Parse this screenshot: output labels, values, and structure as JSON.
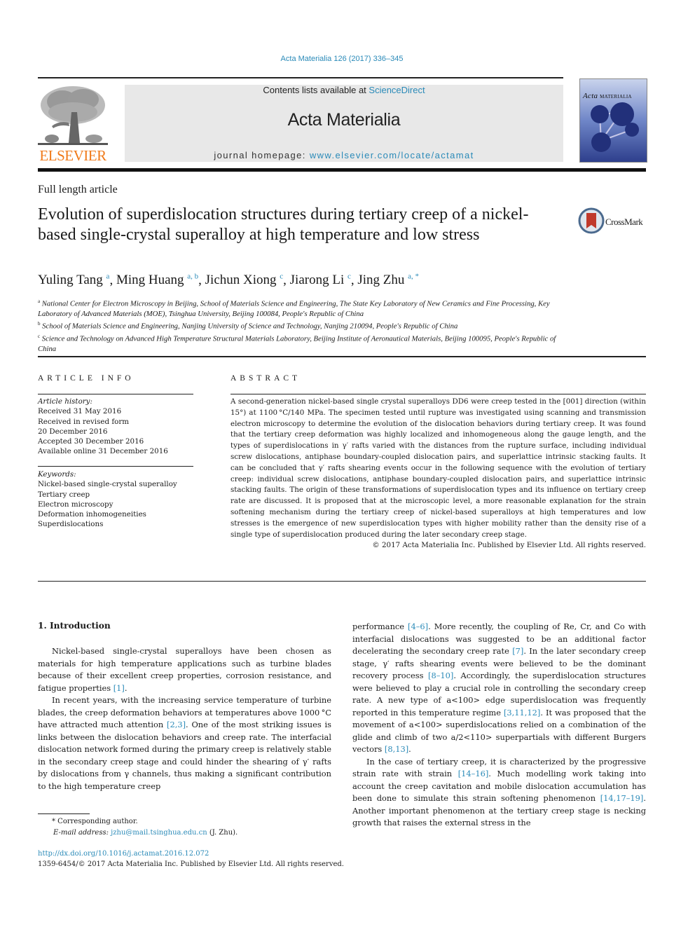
{
  "header": {
    "citation": "Acta Materialia 126 (2017) 336–345",
    "contents_prefix": "Contents lists available at ",
    "contents_link": "ScienceDirect",
    "journal_title": "Acta Materialia",
    "homepage_prefix": "journal homepage: ",
    "homepage_link": "www.elsevier.com/locate/actamat",
    "publisher_logo_text": "ELSEVIER",
    "cover_title_italic": "Acta",
    "cover_title_caps": "MATERIALIA",
    "crossmark_label": "CrossMark"
  },
  "article": {
    "type": "Full length article",
    "title": "Evolution of superdislocation structures during tertiary creep of a nickel-based single-crystal superalloy at high temperature and low stress",
    "authors": [
      {
        "name": "Yuling Tang",
        "sup": "a"
      },
      {
        "name": "Ming Huang",
        "sup": "a, b"
      },
      {
        "name": "Jichun Xiong",
        "sup": "c"
      },
      {
        "name": "Jiarong Li",
        "sup": "c"
      },
      {
        "name": "Jing Zhu",
        "sup": "a, *"
      }
    ],
    "affiliations": [
      {
        "key": "a",
        "text": "National Center for Electron Microscopy in Beijing, School of Materials Science and Engineering, The State Key Laboratory of New Ceramics and Fine Processing, Key Laboratory of Advanced Materials (MOE), Tsinghua University, Beijing 100084, People's Republic of China"
      },
      {
        "key": "b",
        "text": "School of Materials Science and Engineering, Nanjing University of Science and Technology, Nanjing 210094, People's Republic of China"
      },
      {
        "key": "c",
        "text": "Science and Technology on Advanced High Temperature Structural Materials Laboratory, Beijing Institute of Aeronautical Materials, Beijing 100095, People's Republic of China"
      }
    ]
  },
  "article_info": {
    "heading": "ARTICLE INFO",
    "history_label": "Article history:",
    "history": [
      "Received 31 May 2016",
      "Received in revised form",
      "20 December 2016",
      "Accepted 30 December 2016",
      "Available online 31 December 2016"
    ],
    "keywords_label": "Keywords:",
    "keywords": [
      "Nickel-based single-crystal superalloy",
      "Tertiary creep",
      "Electron microscopy",
      "Deformation inhomogeneities",
      "Superdislocations"
    ]
  },
  "abstract": {
    "heading": "ABSTRACT",
    "text": "A second-generation nickel-based single crystal superalloys DD6 were creep tested in the [001] direction (within 15°) at 1100 °C/140 MPa. The specimen tested until rupture was investigated using scanning and transmission electron microscopy to determine the evolution of the dislocation behaviors during tertiary creep. It was found that the tertiary creep deformation was highly localized and inhomogeneous along the gauge length, and the types of superdislocations in γ′ rafts varied with the distances from the rupture surface, including individual screw dislocations, antiphase boundary-coupled dislocation pairs, and superlattice intrinsic stacking faults. It can be concluded that γ′ rafts shearing events occur in the following sequence with the evolution of tertiary creep: individual screw dislocations, antiphase boundary-coupled dislocation pairs, and superlattice intrinsic stacking faults. The origin of these transformations of superdislocation types and its influence on tertiary creep rate are discussed. It is proposed that at the microscopic level, a more reasonable explanation for the strain softening mechanism during the tertiary creep of nickel-based superalloys at high temperatures and low stresses is the emergence of new superdislocation types with higher mobility rather than the density rise of a single type of superdislocation produced during the later secondary creep stage.",
    "copyright": "© 2017 Acta Materialia Inc. Published by Elsevier Ltd. All rights reserved."
  },
  "introduction": {
    "heading": "1.  Introduction",
    "p1_a": "Nickel-based single-crystal superalloys have been chosen as materials for high temperature applications such as turbine blades because of their excellent creep properties, corrosion resistance, and fatigue properties ",
    "p1_ref1": "[1]",
    "p1_b": ".",
    "p2_a": "In recent years, with the increasing service temperature of turbine blades, the creep deformation behaviors at temperatures above 1000 °C have attracted much attention ",
    "p2_ref1": "[2,3]",
    "p2_b": ". One of the most striking issues is links between the dislocation behaviors and creep rate. The interfacial dislocation network formed during the primary creep is relatively stable in the secondary creep stage and could hinder the shearing of γ′ rafts by dislocations from γ channels, thus making a significant contribution to the high temperature creep performance ",
    "p2_ref2": "[4–6]",
    "p2_c": ". More recently, the coupling of Re, Cr, and Co with interfacial dislocations was suggested to be an additional factor decelerating the secondary creep rate ",
    "p2_ref3": "[7]",
    "p2_d": ". In the later secondary creep stage, γ′ rafts shearing events were believed to be the dominant recovery process ",
    "p2_ref4": "[8–10]",
    "p2_e": ". Accordingly, the superdislocation structures were believed to play a crucial role in controlling the secondary creep rate. A new type of a<100> edge superdislocation was frequently reported in this temperature regime ",
    "p2_ref5": "[3,11,12]",
    "p2_f": ". It was proposed that the movement of a<100> superdislocations relied on a combination of the glide and climb of two a/2<110> superpartials with different Burgers vectors ",
    "p2_ref6": "[8,13]",
    "p2_g": ".",
    "p3_a": "In the case of tertiary creep, it is characterized by the progressive strain rate with strain ",
    "p3_ref1": "[14–16]",
    "p3_b": ". Much modelling work taking into account the creep cavitation and mobile dislocation accumulation has been done to simulate this strain softening phenomenon ",
    "p3_ref2": "[14,17–19]",
    "p3_c": ". Another important phenomenon at the tertiary creep stage is necking growth that raises the external stress in the"
  },
  "footnotes": {
    "corresponding": "* Corresponding author.",
    "email_label": "E-mail address: ",
    "email": "jzhu@mail.tsinghua.edu.cn",
    "email_suffix": " (J. Zhu).",
    "doi": "http://dx.doi.org/10.1016/j.actamat.2016.12.072",
    "issn_line": "1359-6454/© 2017 Acta Materialia Inc. Published by Elsevier Ltd. All rights reserved."
  },
  "colors": {
    "link": "#2a8ab8",
    "elsevier_orange": "#f07a1a",
    "banner_bg": "#e8e8e8"
  }
}
